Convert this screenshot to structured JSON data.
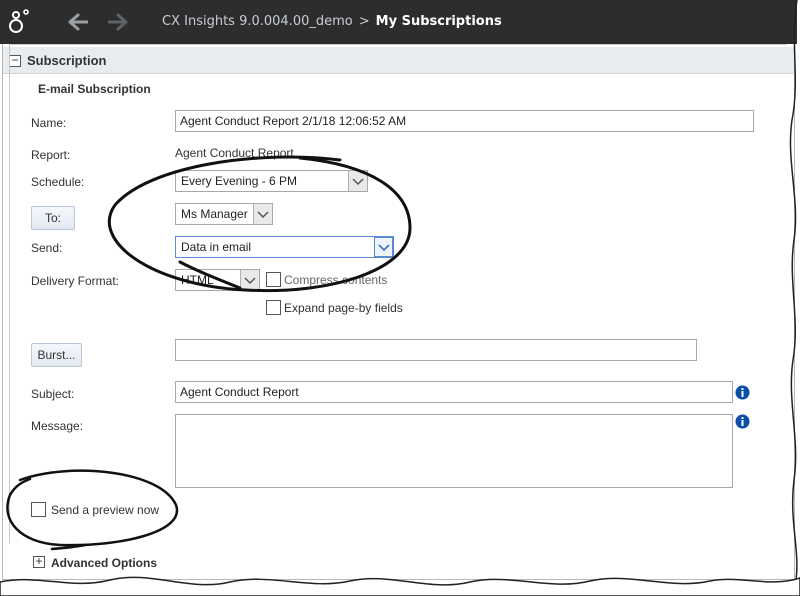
{
  "header": {
    "app_name": "CX Insights 9.0.004.00_demo",
    "separator": ">",
    "current_page": "My Subscriptions",
    "bg_color": "#2d2d2d"
  },
  "section": {
    "collapse_symbol": "−",
    "title": "Subscription",
    "legend": "E-mail Subscription"
  },
  "form": {
    "name_label": "Name:",
    "name_value": "Agent Conduct Report 2/1/18 12:06:52 AM",
    "report_label": "Report:",
    "report_value": "Agent Conduct Report",
    "schedule_label": "Schedule:",
    "schedule_value": "Every Evening - 6 PM",
    "to_button": "To:",
    "to_value": "Ms Manager",
    "send_label": "Send:",
    "send_value": "Data in email",
    "delivery_format_label": "Delivery Format:",
    "delivery_format_value": "HTML",
    "compress_label": "Compress contents",
    "expand_label": "Expand page-by fields",
    "burst_button": "Burst...",
    "burst_value": "",
    "subject_label": "Subject:",
    "subject_value": "Agent Conduct Report",
    "message_label": "Message:",
    "message_value": "",
    "preview_label": "Send a preview now",
    "advanced_symbol": "+",
    "advanced_label": "Advanced Options"
  },
  "icons": {
    "logo": "genesys-logo-icon",
    "back": "back-arrow-icon",
    "forward": "forward-arrow-icon",
    "info": "info-icon",
    "dropdown": "chevron-down-icon"
  },
  "colors": {
    "info_icon": "#0b4fa8",
    "section_bar": "#e9ecef",
    "annotation_ink": "#111111"
  }
}
